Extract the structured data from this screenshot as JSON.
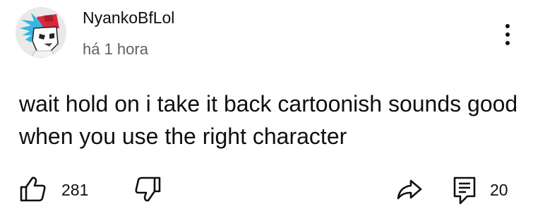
{
  "comment": {
    "author": "NyankoBfLol",
    "timestamp": "há 1 hora",
    "text": "wait hold on i take it back cartoonish sounds good when you use the right character",
    "like_count": "281",
    "reply_count": "20"
  },
  "icons": {
    "avatar": "character-avatar",
    "more": "more-vertical-icon",
    "like": "thumbs-up-icon",
    "dislike": "thumbs-down-icon",
    "share": "share-icon",
    "reply": "comment-icon"
  },
  "colors": {
    "text": "#0f0f0f",
    "secondary_text": "#606060",
    "avatar_hair": "#36b6e0",
    "avatar_cap": "#d9283b"
  }
}
